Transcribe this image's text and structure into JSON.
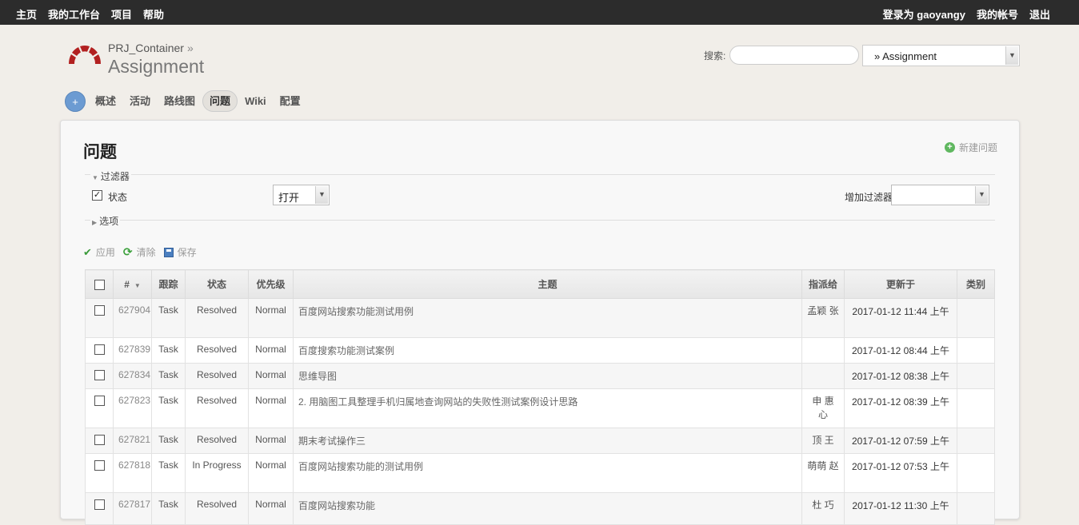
{
  "top_menu": {
    "left": [
      "主页",
      "我的工作台",
      "项目",
      "帮助"
    ],
    "logged_in_prefix": "登录为",
    "username": "gaoyangy",
    "my_account": "我的帐号",
    "logout": "退出"
  },
  "header": {
    "parent_project": "PRJ_Container",
    "parent_sep": "»",
    "project_title": "Assignment",
    "search_label": "搜索:",
    "search_value": "",
    "project_jump": "» Assignment"
  },
  "main_menu": {
    "new_object": "+",
    "tabs": [
      "概述",
      "活动",
      "路线图",
      "问题",
      "Wiki",
      "配置"
    ],
    "selected": "问题"
  },
  "content": {
    "heading": "问题",
    "new_issue": "新建问题",
    "filters_legend": "过滤器",
    "status_label": "状态",
    "status_checked": true,
    "status_operator": "打开",
    "add_filter_label": "增加过滤器",
    "add_filter_value": "",
    "options_legend": "选项",
    "actions": {
      "apply": "应用",
      "clear": "清除",
      "save": "保存"
    }
  },
  "issue_table": {
    "columns": [
      "#",
      "跟踪",
      "状态",
      "优先级",
      "主题",
      "指派给",
      "更新于",
      "类别"
    ],
    "rows": [
      {
        "id": "627904",
        "tracker": "Task",
        "status": "Resolved",
        "priority": "Normal",
        "subject": "百度网站搜索功能测试用例",
        "assignee": "孟颖 张",
        "updated": "2017-01-12 11:44 上午",
        "category": ""
      },
      {
        "id": "627839",
        "tracker": "Task",
        "status": "Resolved",
        "priority": "Normal",
        "subject": "百度搜索功能测试案例",
        "assignee": "",
        "updated": "2017-01-12 08:44 上午",
        "category": ""
      },
      {
        "id": "627834",
        "tracker": "Task",
        "status": "Resolved",
        "priority": "Normal",
        "subject": "思维导图",
        "assignee": "",
        "updated": "2017-01-12 08:38 上午",
        "category": ""
      },
      {
        "id": "627823",
        "tracker": "Task",
        "status": "Resolved",
        "priority": "Normal",
        "subject": "2. 用脑图工具整理手机归属地查询网站的失败性测试案例设计思路",
        "assignee": "申 惠 心",
        "updated": "2017-01-12 08:39 上午",
        "category": ""
      },
      {
        "id": "627821",
        "tracker": "Task",
        "status": "Resolved",
        "priority": "Normal",
        "subject": "期末考试操作三",
        "assignee": "顶 王",
        "updated": "2017-01-12 07:59 上午",
        "category": ""
      },
      {
        "id": "627818",
        "tracker": "Task",
        "status": "In Progress",
        "priority": "Normal",
        "subject": "百度网站搜索功能的测试用例",
        "assignee": "萌萌 赵",
        "updated": "2017-01-12 07:53 上午",
        "category": ""
      },
      {
        "id": "627817",
        "tracker": "Task",
        "status": "Resolved",
        "priority": "Normal",
        "subject": "百度网站搜索功能",
        "assignee": "杜 巧",
        "updated": "2017-01-12 11:30 上午",
        "category": ""
      }
    ]
  }
}
